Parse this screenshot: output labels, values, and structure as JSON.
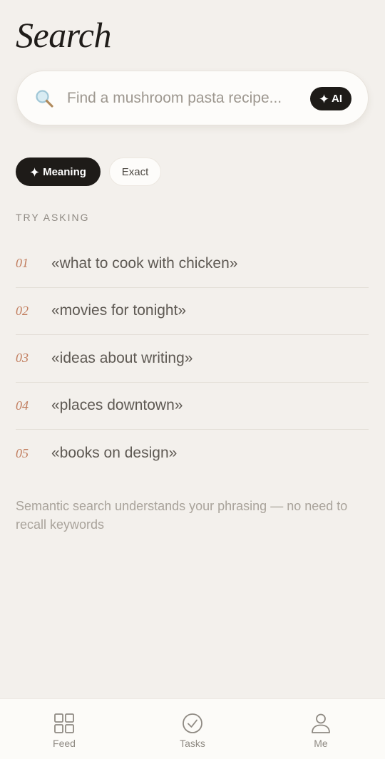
{
  "header": {
    "title": "Search"
  },
  "search": {
    "placeholder": "Find a mushroom pasta recipe...",
    "ai_label": "AI",
    "ai_icon": "sparkle-icon"
  },
  "modes": [
    {
      "label": "Meaning",
      "active": true,
      "icon": "sparkle-icon"
    },
    {
      "label": "Exact",
      "active": false
    }
  ],
  "try_asking": {
    "label": "TRY ASKING",
    "items": [
      {
        "num": "01",
        "text": "«what to cook with chicken»"
      },
      {
        "num": "02",
        "text": "«movies for tonight»"
      },
      {
        "num": "03",
        "text": "«ideas about writing»"
      },
      {
        "num": "04",
        "text": "«places downtown»"
      },
      {
        "num": "05",
        "text": "«books on design»"
      }
    ]
  },
  "hint": "Semantic search understands your phrasing — no need to recall keywords",
  "bottom_nav": [
    {
      "label": "Feed",
      "icon": "grid-icon"
    },
    {
      "label": "Tasks",
      "icon": "check-circle-icon"
    },
    {
      "label": "Me",
      "icon": "person-icon"
    }
  ],
  "colors": {
    "background": "#f3f0ec",
    "accent_dark": "#1e1b18",
    "number_accent": "#c17d5e"
  }
}
